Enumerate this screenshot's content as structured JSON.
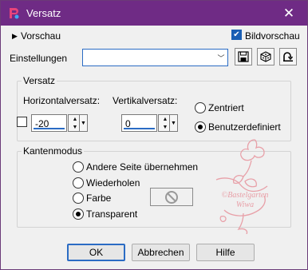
{
  "window": {
    "title": "Versatz"
  },
  "top": {
    "preview_label": "Vorschau",
    "image_preview_label": "Bildvorschau",
    "image_preview_checked": true,
    "settings_label": "Einstellungen",
    "settings_value": ""
  },
  "offset": {
    "group_title": "Versatz",
    "horizontal_label": "Horizontalversatz:",
    "horizontal_value": "-20",
    "vertical_label": "Vertikalversatz:",
    "vertical_value": "0",
    "centered_label": "Zentriert",
    "custom_label": "Benutzerdefiniert",
    "selected": "custom"
  },
  "edge": {
    "group_title": "Kantenmodus",
    "options": [
      "Andere Seite übernehmen",
      "Wiederholen",
      "Farbe",
      "Transparent"
    ],
    "selected": "Transparent"
  },
  "watermark": {
    "line1": "©Bastelgarten",
    "line2": "Wiwa"
  },
  "buttons": {
    "ok": "OK",
    "cancel": "Abbrechen",
    "help": "Hilfe"
  },
  "colors": {
    "titlebar": "#6f2b85",
    "accent": "#2b6cc4",
    "watermark": "#e8a0a8"
  }
}
